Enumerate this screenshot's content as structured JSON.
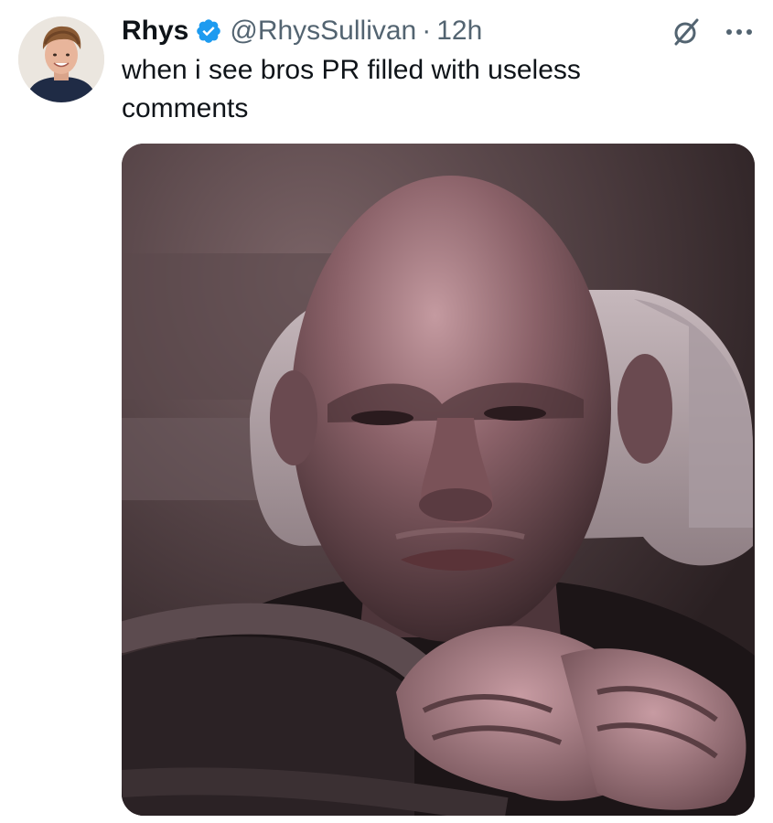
{
  "tweet": {
    "author": {
      "display_name": "Rhys",
      "handle": "@RhysSullivan",
      "verified": true,
      "avatar_icon": "profile-photo"
    },
    "separator": "·",
    "timestamp": "12h",
    "text": "when i see bros PR filled with useless comments",
    "media": {
      "kind": "animated-gif-still",
      "subject": "bald man in a car seat holding a steering wheel, squinting"
    },
    "actions": {
      "grok_icon": "grok-icon",
      "more_icon": "more-options-icon"
    }
  },
  "colors": {
    "text_primary": "#0f1419",
    "text_secondary": "#536471",
    "verified_blue": "#1d9bf0",
    "background": "#ffffff"
  }
}
